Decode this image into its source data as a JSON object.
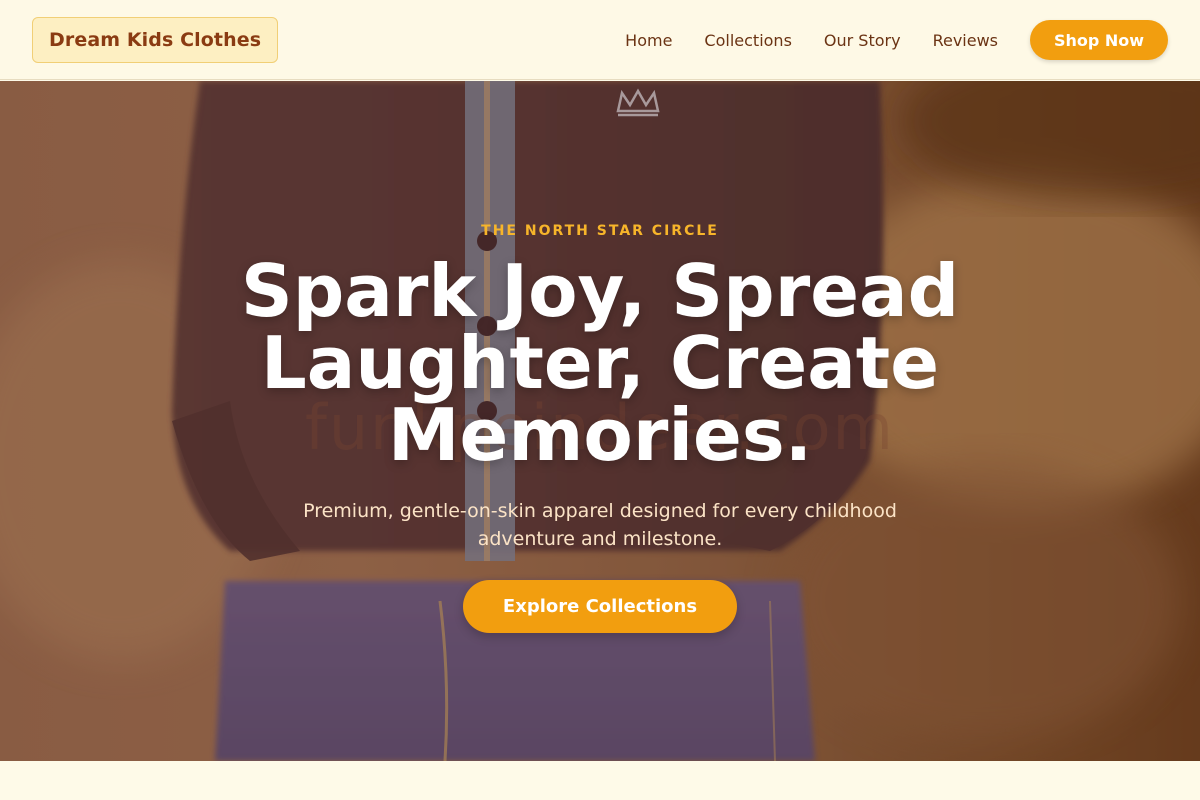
{
  "header": {
    "logo": "Dream Kids Clothes",
    "nav": {
      "home": "Home",
      "collections": "Collections",
      "our_story": "Our Story",
      "reviews": "Reviews"
    },
    "shop_now": "Shop Now"
  },
  "hero": {
    "eyebrow": "THE NORTH STAR CIRCLE",
    "headline": "Spark Joy, Spread Laughter, Create Memories.",
    "subtext": "Premium, gentle-on-skin apparel designed for every childhood adventure and milestone.",
    "cta": "Explore Collections",
    "watermark": "funkpeindeer.com"
  },
  "colors": {
    "accent": "#f29e0f",
    "brand_text": "#8a3b12",
    "eyebrow": "#f7b52a",
    "page_bg": "#fefae8"
  }
}
